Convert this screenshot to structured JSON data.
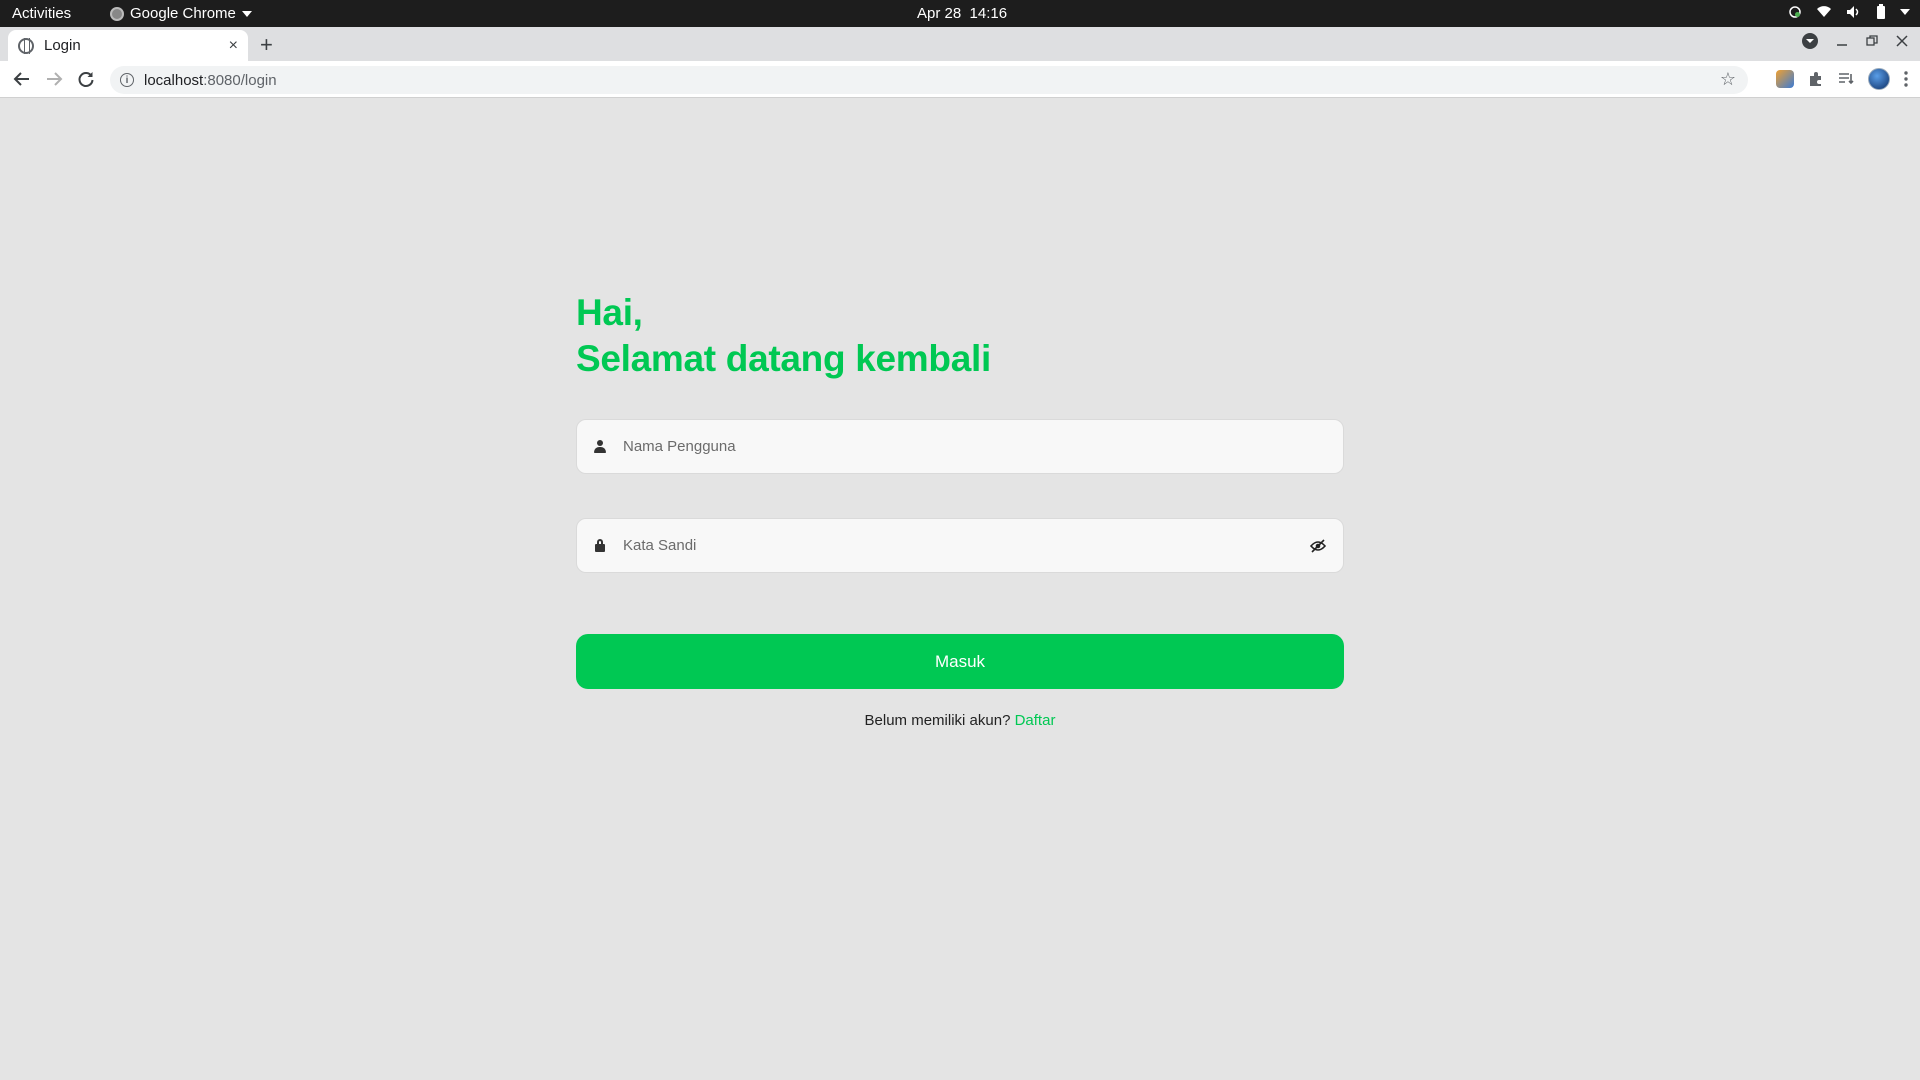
{
  "os_bar": {
    "activities": "Activities",
    "app_name": "Google Chrome",
    "date": "Apr 28",
    "time": "14:16"
  },
  "browser": {
    "tab_title": "Login",
    "tab_close": "×",
    "new_tab": "+",
    "url_host": "localhost",
    "url_path": ":8080/login",
    "icons": [
      "back-arrow-icon",
      "forward-arrow-icon",
      "reload-icon",
      "site-info-icon",
      "bookmark-star-icon",
      "extensions-puzzle-icon",
      "reading-list-icon",
      "profile-avatar-icon",
      "more-menu-icon"
    ]
  },
  "login": {
    "greeting_line1": "Hai,",
    "greeting_line2": "Selamat datang kembali",
    "username_placeholder": "Nama Pengguna",
    "password_placeholder": "Kata Sandi",
    "submit_label": "Masuk",
    "signup_prompt": "Belum memiliki akun?",
    "signup_link": "Daftar",
    "accent_color": "#00c853"
  }
}
